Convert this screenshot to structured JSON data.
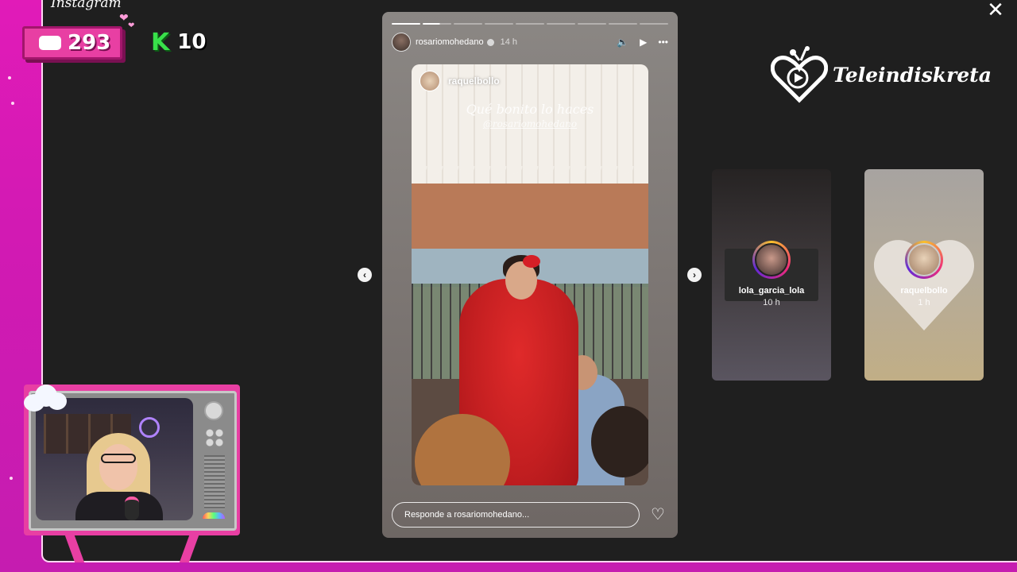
{
  "overlay": {
    "platform_label": "Instagram",
    "counters": {
      "youtube": {
        "icon": "youtube-icon",
        "value": "293"
      },
      "kick": {
        "icon": "kick-k-icon",
        "value": "10"
      }
    },
    "brand": {
      "logo_icon": "heart-tv-play-icon",
      "text": "Teleindiskreta"
    }
  },
  "story": {
    "progress": {
      "segments": 9,
      "completed": 1,
      "current_fraction": 0.6
    },
    "author": "rosariomohedano",
    "verified": true,
    "time": "14 h",
    "controls": {
      "mute": "speaker-icon",
      "play": "play-icon",
      "more": "more-dots-icon"
    },
    "reshared_post": {
      "author": "raquelbollo",
      "caption": "Qué bonito lo haces",
      "mention": "@rosariomohedano"
    },
    "reply_placeholder": "Responde a rosariomohedano...",
    "like_icon": "heart-outline-icon"
  },
  "navigation": {
    "prev_icon": "chevron-left-icon",
    "next_icon": "chevron-right-icon",
    "close_icon": "close-icon"
  },
  "up_next": [
    {
      "user": "lola_garcia_lola",
      "time": "10 h"
    },
    {
      "user": "raquelbollo",
      "time": "1 h"
    }
  ],
  "colors": {
    "overlay_pink": "#e83fa3",
    "kick_green": "#38e04a",
    "story_ring": [
      "#f9c02b",
      "#ee2a7b",
      "#6228d7"
    ]
  }
}
